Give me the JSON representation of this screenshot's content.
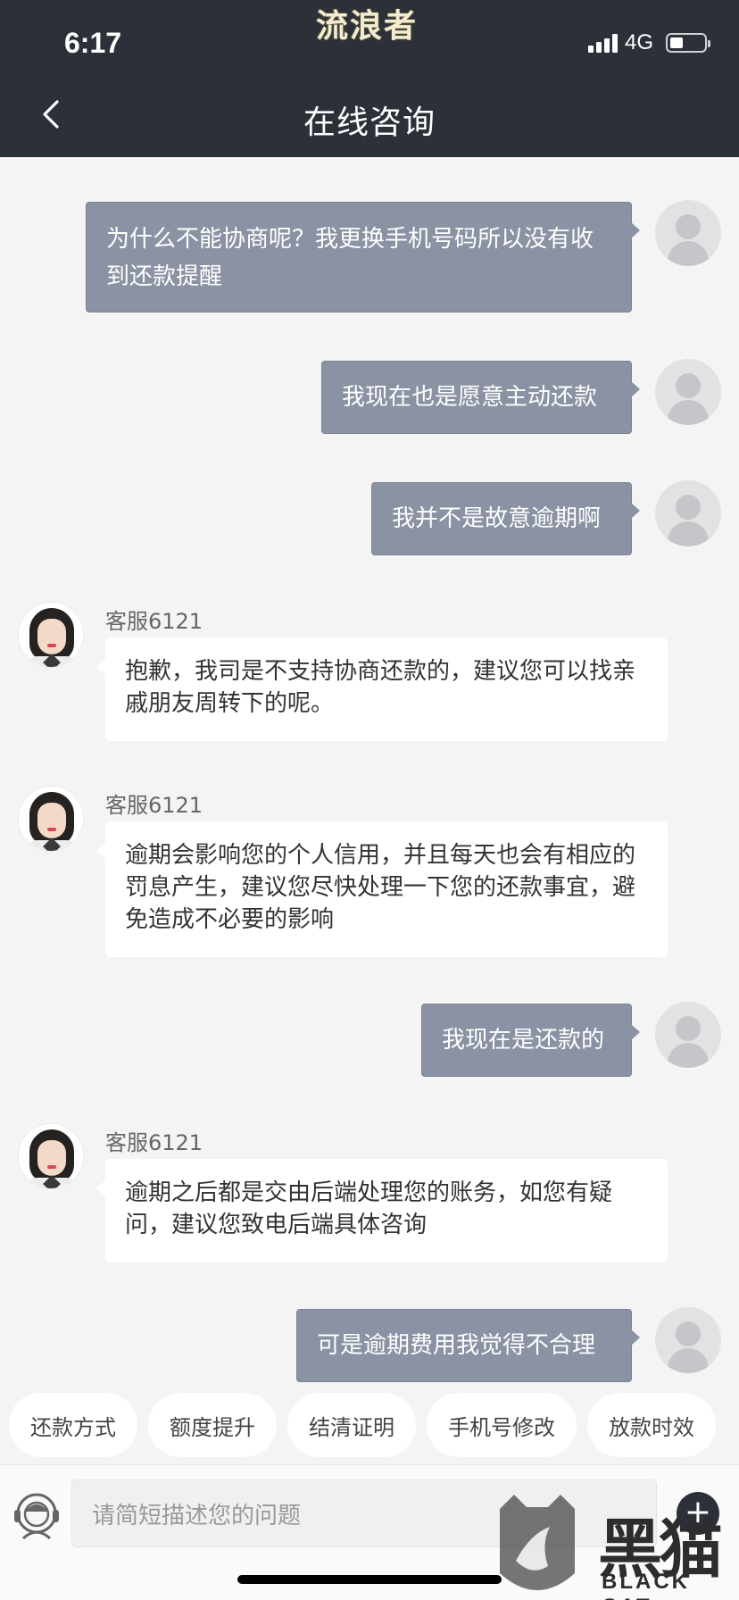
{
  "status_bar": {
    "time": "6:17",
    "network": "4G"
  },
  "watermark_top": "流浪者",
  "header": {
    "title": "在线咨询"
  },
  "messages": [
    {
      "sender": "user",
      "text": "为什么不能协商呢？我更换手机号码所以没有收到还款提醒"
    },
    {
      "sender": "user",
      "text": "我现在也是愿意主动还款"
    },
    {
      "sender": "user",
      "text": "我并不是故意逾期啊"
    },
    {
      "sender": "agent",
      "name": "客服6121",
      "text": "抱歉，我司是不支持协商还款的，建议您可以找亲戚朋友周转下的呢。"
    },
    {
      "sender": "agent",
      "name": "客服6121",
      "text": "逾期会影响您的个人信用，并且每天也会有相应的罚息产生，建议您尽快处理一下您的还款事宜，避免造成不必要的影响"
    },
    {
      "sender": "user",
      "text": "我现在是还款的"
    },
    {
      "sender": "agent",
      "name": "客服6121",
      "text": "逾期之后都是交由后端处理您的账务，如您有疑问，建议您致电后端具体咨询"
    },
    {
      "sender": "user",
      "text": "可是逾期费用我觉得不合理"
    }
  ],
  "quick_replies": [
    "还款方式",
    "额度提升",
    "结清证明",
    "手机号修改",
    "放款时效"
  ],
  "input": {
    "placeholder": "请简短描述您的问题"
  },
  "watermark_logo": {
    "cn": "黑猫",
    "en": "BLACK CAT"
  }
}
